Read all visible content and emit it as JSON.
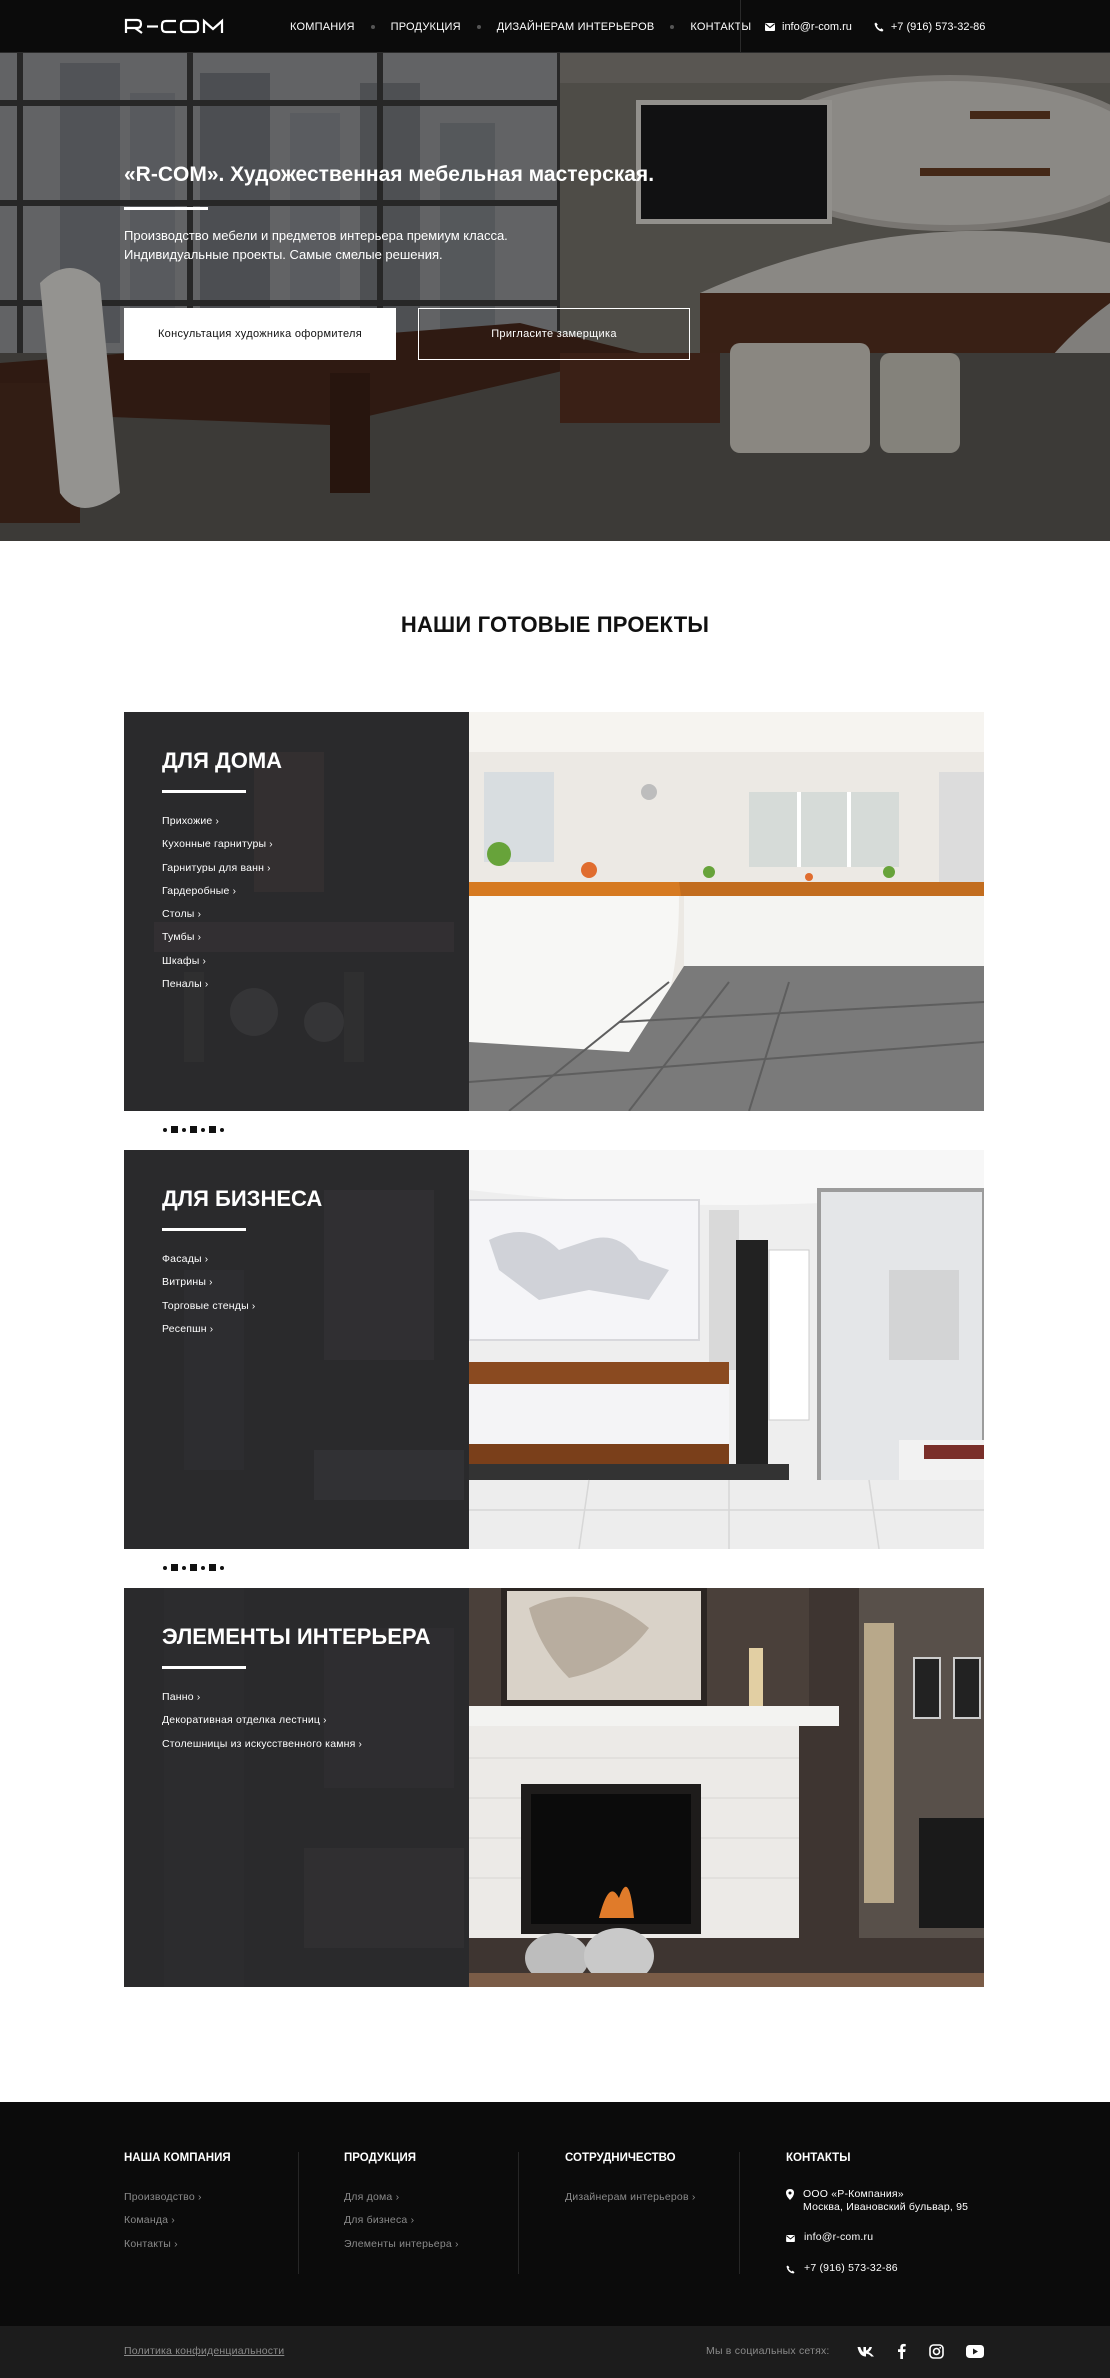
{
  "brand": {
    "logo_text": "R-COM"
  },
  "nav": {
    "items": [
      {
        "label": "Компания"
      },
      {
        "label": "Продукция"
      },
      {
        "label": "Дизайнерам интерьеров"
      },
      {
        "label": "Контакты"
      }
    ],
    "email": "info@r-com.ru",
    "phone": "+7 (916) 573-32-86"
  },
  "hero": {
    "title": "«R-COM». Художественная мебельная мастерская.",
    "subtitle_line1": "Производство мебели и предметов интерьера премиум класса.",
    "subtitle_line2": "Индивидуальные проекты. Самые смелые решения.",
    "primary_button": "Консультация художника оформителя",
    "secondary_button": "Пригласите замерщика"
  },
  "projects": {
    "section_title": "НАШИ ГОТОВЫЕ ПРОЕКТЫ",
    "cards": [
      {
        "title": "Для дома",
        "links": [
          "Прихожие",
          "Кухонные гарнитуры",
          "Гарнитуры для ванн",
          "Гардеробные",
          "Столы",
          "Тумбы",
          "Шкафы",
          "Пеналы"
        ]
      },
      {
        "title": "Для бизнеса",
        "links": [
          "Фасады",
          "Витрины",
          "Торговые стенды",
          "Ресепшн"
        ]
      },
      {
        "title": "Элементы интерьера",
        "links": [
          "Панно",
          "Декоративная отделка лестниц",
          "Столешницы из искусственного камня"
        ]
      }
    ]
  },
  "footer": {
    "company": {
      "title": "Наша компания",
      "links": [
        "Производство",
        "Команда",
        "Контакты"
      ]
    },
    "products": {
      "title": "Продукция",
      "links": [
        "Для дома",
        "Для бизнеса",
        "Элементы интерьера"
      ]
    },
    "cooperation": {
      "title": "Сотрудничество",
      "links": [
        "Дизайнерам интерьеров"
      ]
    },
    "contacts": {
      "title": "Контакты",
      "address_line1": "ООО «Р-Компания»",
      "address_line2": "Москва, Ивановский бульвар, 95",
      "email": "info@r-com.ru",
      "phone": "+7 (916) 573-32-86"
    },
    "policy": "Политика конфиденциальности",
    "social_label": "Мы в социальных сетях:",
    "social_icons": [
      "vk-icon",
      "facebook-icon",
      "instagram-icon",
      "youtube-icon"
    ]
  },
  "colors": {
    "nav_bg": "#0b0b0b",
    "card_overlay": "#2a2a2c",
    "footer_bg": "#0b0b0b",
    "subfooter_bg": "#1c1c1c",
    "muted_text": "#8a8a8a"
  }
}
